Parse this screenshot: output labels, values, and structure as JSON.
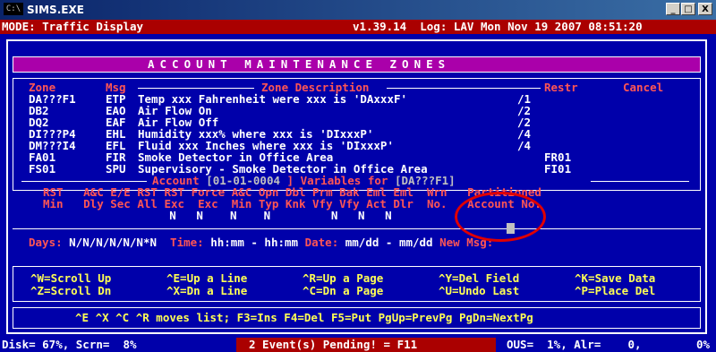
{
  "window": {
    "title": "SIMS.EXE",
    "icon": "cmd-icon",
    "min_label": "_",
    "max_label": "□",
    "close_label": "X"
  },
  "status": {
    "mode": "MODE: Traffic Display",
    "version_log": "v1.39.14  Log: LAV Mon Nov 19 2007 08:51:20"
  },
  "banner": "ACCOUNT MAINTENANCE ZONES",
  "zones_header": {
    "zone": "Zone",
    "msg": "Msg",
    "desc": "Zone Description",
    "restr": "Restr",
    "cancel": "Cancel"
  },
  "zones": [
    {
      "zone": "DA???F1",
      "msg": "ETP",
      "desc": "Temp xxx Fahrenheit were xxx is 'DAxxxF'",
      "restr": "/1"
    },
    {
      "zone": "DB2",
      "msg": "EAO",
      "desc": "Air Flow On",
      "restr": "/2"
    },
    {
      "zone": "DQ2",
      "msg": "EAF",
      "desc": "Air Flow Off",
      "restr": "/2"
    },
    {
      "zone": "DI???P4",
      "msg": "EHL",
      "desc": "Humidity xxx% where xxx is 'DIxxxP'",
      "restr": "/4"
    },
    {
      "zone": "DM???I4",
      "msg": "EFL",
      "desc": "Fluid xxx Inches where xxx is 'DIxxxP'",
      "restr": "/4"
    },
    {
      "zone": "FA01",
      "msg": "FIR",
      "desc": "Smoke Detector in Office Area",
      "restr": "FR01"
    },
    {
      "zone": "FS01",
      "msg": "SPU",
      "desc": "Supervisory - Smoke Detector in Office Area",
      "restr": "FI01"
    }
  ],
  "account_bar": {
    "prefix": "Account ",
    "account": "[01-01-0004",
    " vars": " ] Variables for ",
    "zone": "[DA???F1]"
  },
  "vars_row1": "RST   A&C E/E RST RST Force A&C Opn Dbl Prm Bak Eml Eml  Wrn   Partitioned",
  "vars_row2": "Min   Dly Sec All Exc  Exc  Min Typ Knk Vfy Vfy Act Dlr  No.   Account No.",
  "vars_row3": "          N   N    N    N         N   N   N",
  "days_row": {
    "days_label": "Days: ",
    "days": "N/N/N/N/N/N*N",
    "time_label": "  Time: ",
    "time": "hh:mm - hh:mm",
    "date_label": " Date: ",
    "date": "mm/dd - mm/dd",
    "newmsg": " New Msg:"
  },
  "keys": [
    [
      "^W=Scroll Up",
      "^E=Up a Line",
      "^R=Up a Page",
      "^Y=Del Field",
      "^K=Save Data"
    ],
    [
      "^Z=Scroll Dn",
      "^X=Dn a Line",
      "^C=Dn a Page",
      "^U=Undo Last",
      "^P=Place Del"
    ]
  ],
  "help_line": "^E ^X ^C ^R moves list; F3=Ins F4=Del F5=Put PgUp=PrevPg PgDn=NextPg",
  "bottom": {
    "disk": "Disk= 67%, Scrn=  8%",
    "events": "2 Event(s) Pending! = F11",
    "ous": "OUS=  1%, Alr=    0,",
    "pct": "0%"
  },
  "colors": {
    "background": "#0000aa",
    "status_bar": "#aa0000",
    "banner": "#aa00aa",
    "annotation_circle": "#e00000"
  }
}
